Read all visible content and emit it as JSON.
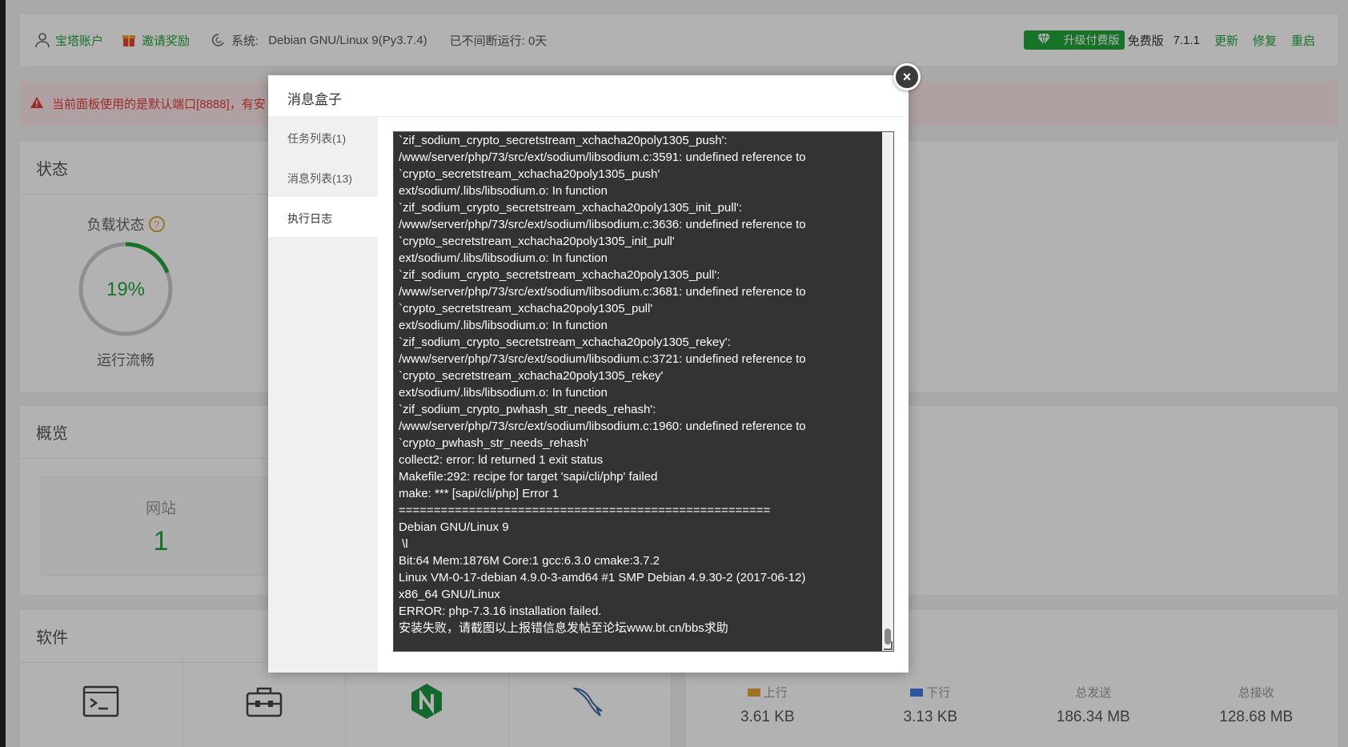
{
  "topbar": {
    "account": "宝塔账户",
    "invite": "邀请奖励",
    "system_label": "系统:",
    "system_value": "Debian GNU/Linux 9(Py3.7.4)",
    "uptime": "已不间断运行: 0天",
    "upgrade_badge": "升级付费版",
    "edition": "免费版",
    "version": "7.1.1",
    "update": "更新",
    "repair": "修复",
    "restart": "重启"
  },
  "warning": {
    "text": "当前面板使用的是默认端口[8888]，有安"
  },
  "status_panel": {
    "title": "状态",
    "load_label": "负载状态",
    "help": "?",
    "load_percent": "19%",
    "load_value": 19,
    "load_status": "运行流畅"
  },
  "overview_panel": {
    "title": "概览",
    "site_label": "网站",
    "site_count": "1"
  },
  "software_panel": {
    "title": "软件",
    "items": [
      {
        "icon": "terminal-icon"
      },
      {
        "icon": "toolbox-icon"
      },
      {
        "icon": "nginx-icon"
      },
      {
        "icon": "mysql-dolphin-icon"
      }
    ]
  },
  "traffic_panel": {
    "upload_label": "上行",
    "upload_value": "3.61 KB",
    "download_label": "下行",
    "download_value": "3.13 KB",
    "sent_label": "总发送",
    "sent_value": "186.34 MB",
    "recv_label": "总接收",
    "recv_value": "128.68 MB",
    "upload_color": "#e8a23a",
    "download_color": "#3a7be8"
  },
  "modal": {
    "title": "消息盒子",
    "close": "×",
    "tabs": [
      {
        "label": "任务列表(1)"
      },
      {
        "label": "消息列表(13)"
      },
      {
        "label": "执行日志"
      }
    ],
    "log": "`zif_sodium_crypto_secretstream_xchacha20poly1305_push':\n/www/server/php/73/src/ext/sodium/libsodium.c:3591: undefined reference to\n`crypto_secretstream_xchacha20poly1305_push'\next/sodium/.libs/libsodium.o: In function\n`zif_sodium_crypto_secretstream_xchacha20poly1305_init_pull':\n/www/server/php/73/src/ext/sodium/libsodium.c:3636: undefined reference to\n`crypto_secretstream_xchacha20poly1305_init_pull'\next/sodium/.libs/libsodium.o: In function\n`zif_sodium_crypto_secretstream_xchacha20poly1305_pull':\n/www/server/php/73/src/ext/sodium/libsodium.c:3681: undefined reference to\n`crypto_secretstream_xchacha20poly1305_pull'\next/sodium/.libs/libsodium.o: In function\n`zif_sodium_crypto_secretstream_xchacha20poly1305_rekey':\n/www/server/php/73/src/ext/sodium/libsodium.c:3721: undefined reference to\n`crypto_secretstream_xchacha20poly1305_rekey'\next/sodium/.libs/libsodium.o: In function\n`zif_sodium_crypto_pwhash_str_needs_rehash':\n/www/server/php/73/src/ext/sodium/libsodium.c:1960: undefined reference to\n`crypto_pwhash_str_needs_rehash'\ncollect2: error: ld returned 1 exit status\nMakefile:292: recipe for target 'sapi/cli/php' failed\nmake: *** [sapi/cli/php] Error 1\n=====================================================\nDebian GNU/Linux 9\n \\l\nBit:64 Mem:1876M Core:1 gcc:6.3.0 cmake:3.7.2\nLinux VM-0-17-debian 4.9.0-3-amd64 #1 SMP Debian 4.9.30-2 (2017-06-12)\nx86_64 GNU/Linux\nERROR: php-7.3.16 installation failed.\n安装失败，请截图以上报错信息发帖至论坛www.bt.cn/bbs求助"
  },
  "colors": {
    "brand_green": "#20a53a",
    "warning_red": "#e43c3c",
    "log_bg": "#333333"
  }
}
